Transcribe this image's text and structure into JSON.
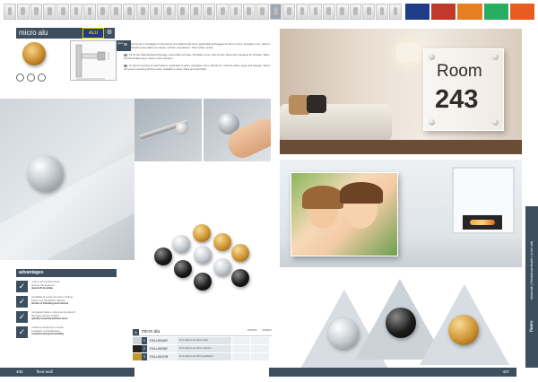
{
  "header": {
    "title": "micro alu",
    "logo_text": "ALU",
    "icon": "gear-icon"
  },
  "spec_box": {
    "text": "spec"
  },
  "text_blocks": [
    "Sistema per il montaggio di pannelli ad una distanza dal muro, applicabile al fissaggio di lastre in vetro, plexiglas, forex, dibond etc. Particolarmente adatto per targhe, cartelli e segnaletica. Tutto incluso nel kit.",
    "Kit für den Wandabstand-Montage, anwendbar auf Glas, Plexiglas, Forex, Dibond usw. Besonders geeignet für Schilder, Tafeln und Beschilderungen. Alles im Set enthalten.",
    "for panel mounting at wall distance, applicable to glass, plexiglass, forex, dibond etc. Ideal for plates, signs and signage. Stand-off system including all fixing parts, available in silver, black and gold finish."
  ],
  "advantages": {
    "title": "advantages",
    "items": [
      {
        "it": "minimo ad elevata tenuta",
        "de": "geringe Montagezeit",
        "en": "stand-off invisible"
      },
      {
        "it": "possibilità di scelta fra colori e finiture",
        "de": "Farbe und Oberfläche wählbar",
        "en": "choice of finishing and colours"
      },
      {
        "it": "montaggio facile e rapido senza attrezzi",
        "de": "Montage schnell, einfach",
        "en": "quickly mounted without tools"
      },
      {
        "it": "massima resistenza e tenuta",
        "de": "Festigkeit und Haltbarkeit",
        "en": "resistant and good holding"
      }
    ]
  },
  "table": {
    "badge": "A",
    "title": "micro alu",
    "col_headers": [
      "Ø18/Ø15",
      "Ø18/Ø15"
    ],
    "rows": [
      {
        "num": "1",
        "code": "FALU50AR",
        "desc": "Kurz-distanz alu 18mm silber",
        "swatch": "#cfd4d8"
      },
      {
        "num": "2",
        "code": "FALU50NE",
        "desc": "Kurz-distanz alu 18mm schwarz",
        "swatch": "#222222"
      },
      {
        "num": "3",
        "code": "FALU50OR",
        "desc": "Kurz-distanz alu 18mm goldfarben",
        "swatch": "#c9952f"
      }
    ]
  },
  "footer": {
    "page_left": "406",
    "section": "floor-wall",
    "page_right": "407"
  },
  "sign": {
    "line1": "Room",
    "line2": "243"
  },
  "side_tab": {
    "text": "distanziali | Wandabstandhalter | to the wall",
    "label": "floors"
  },
  "category_tabs": [
    {
      "color": "#1f3c88"
    },
    {
      "color": "#c0392b"
    },
    {
      "color": "#e67e22"
    },
    {
      "color": "#27ae60"
    },
    {
      "color": "#e85d1f"
    }
  ],
  "colors": {
    "brand": "#3d4f5f",
    "logo_blue": "#1f3c88",
    "logo_yellow": "#e9c800",
    "gold": "#c9952f",
    "silver": "#cfd4d8",
    "black": "#222222"
  }
}
